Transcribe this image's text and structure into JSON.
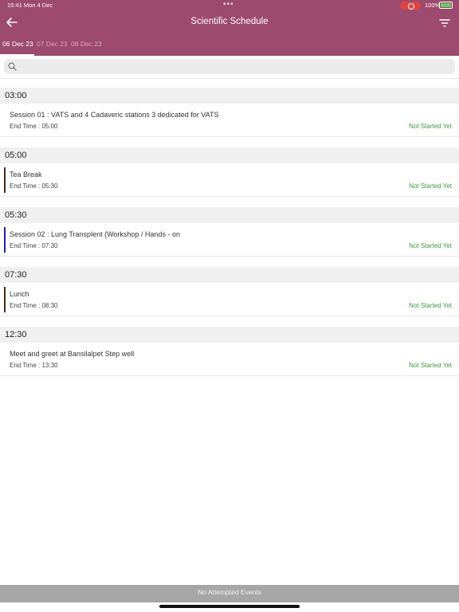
{
  "status_bar": {
    "time": "15:41  Mon 4 Dec",
    "dots": "•••",
    "battery": "100%"
  },
  "header": {
    "title": "Scientific Schedule"
  },
  "tabs": [
    {
      "label": "06 Dec 23",
      "active": true
    },
    {
      "label": "07 Dec 23",
      "active": false
    },
    {
      "label": "08 Dec 23",
      "active": false
    }
  ],
  "search": {
    "placeholder": "",
    "value": ""
  },
  "end_label": "End Time : ",
  "groups": [
    {
      "time": "03:00",
      "items": [
        {
          "name": "Session 01 : VATS and 4 Cadaveric stations 3 dedicated for VATS",
          "end": "05:00",
          "status": "Not Started Yet",
          "color": ""
        }
      ]
    },
    {
      "time": "05:00",
      "items": [
        {
          "name": "Tea Break",
          "end": "05:30",
          "status": "Not Started Yet",
          "color": "#4a2a12"
        }
      ]
    },
    {
      "time": "05:30",
      "items": [
        {
          "name": "Session 02 : Lung Transplent (Workshop / Hands - on",
          "end": "07:30",
          "status": "Not Started Yet",
          "color": "#1a1adf"
        }
      ]
    },
    {
      "time": "07:30",
      "items": [
        {
          "name": "Lunch",
          "end": "08:30",
          "status": "Not Started Yet",
          "color": "#4a2a12"
        }
      ]
    },
    {
      "time": "12:30",
      "items": [
        {
          "name": "Meet and greet at Bansilalpet Step well",
          "end": "13:30",
          "status": "Not Started Yet",
          "color": ""
        }
      ]
    }
  ],
  "footer": {
    "label": "No Attempted Events"
  }
}
